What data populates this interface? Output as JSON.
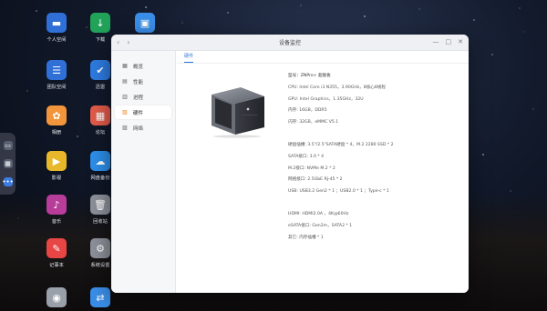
{
  "desktop": {
    "icons": [
      {
        "name": "personal-space",
        "label": "个人空间",
        "color": "#2f6fd6",
        "glyph": "▬"
      },
      {
        "name": "download",
        "label": "下载",
        "color": "#22a35a",
        "glyph": "↓"
      },
      {
        "name": "app-blue",
        "label": "",
        "color": "#3a8ee8",
        "glyph": "▣"
      },
      {
        "name": "team-space",
        "label": "团队空间",
        "color": "#2f6fd6",
        "glyph": "☰"
      },
      {
        "name": "app-v",
        "label": "迅雷",
        "color": "#2d7be0",
        "glyph": "✔"
      },
      {
        "name": "photos",
        "label": "相册",
        "color": "#f2953b",
        "glyph": "✿"
      },
      {
        "name": "app-multi",
        "label": "论坛",
        "color": "#e25b4a",
        "glyph": "▦"
      },
      {
        "name": "movies",
        "label": "影视",
        "color": "#e8b82a",
        "glyph": "▶"
      },
      {
        "name": "cloud-drive",
        "label": "网盘备份",
        "color": "#2d8ee8",
        "glyph": "☁"
      },
      {
        "name": "music",
        "label": "音乐",
        "color": "#b83c9a",
        "glyph": "♪"
      },
      {
        "name": "recycle-bin",
        "label": "回收站",
        "color": "#8c9099",
        "glyph": "🗑"
      },
      {
        "name": "notes",
        "label": "记事本",
        "color": "#e84545",
        "glyph": "✎"
      },
      {
        "name": "system-settings",
        "label": "系统设置",
        "color": "#8c9099",
        "glyph": "⚙"
      },
      {
        "name": "app-gray",
        "label": "",
        "color": "#9aa0aa",
        "glyph": "◉"
      },
      {
        "name": "app-transfer",
        "label": "",
        "color": "#3a8ee8",
        "glyph": "⇄"
      }
    ]
  },
  "dock": {
    "items": [
      "monitor-icon",
      "grid-icon",
      "more-icon"
    ]
  },
  "window": {
    "title": "设备监控",
    "back_glyph": "‹",
    "forward_glyph": "›",
    "minimize_glyph": "—",
    "maximize_glyph": "□",
    "close_glyph": "✕",
    "sidebar": [
      {
        "label": "概览",
        "glyph": "▦",
        "active": false
      },
      {
        "label": "性能",
        "glyph": "▤",
        "active": false
      },
      {
        "label": "进程",
        "glyph": "▥",
        "active": false
      },
      {
        "label": "硬件",
        "glyph": "▧",
        "active": true
      },
      {
        "label": "网络",
        "glyph": "▨",
        "active": false
      }
    ],
    "tab": "硬件",
    "specs": {
      "model": "型号：ZNPro+ 超能板",
      "cpu": "CPU: Intel Core i3 N355，3.90GHz，8核心8线程",
      "gpu": "GPU: Intel Graphics，1.35GHz，32U",
      "memory": "内存: 16GB，DDR5",
      "flash": "闪存: 32GB，eMMC V5.1",
      "disk_slots": "硬盘插槽: 3.5\"/2.5\"SATA硬盘 * 4，M.2 2280 SSD * 2",
      "sata": "SATA接口: 3.0 * 4",
      "m2": "M.2接口: NVMe M.2 * 2",
      "lan": "网络接口: 2.5GbE RJ-45 * 2",
      "usb": "USB: USB3.2 Gen2 * 1 ；USB2.0 * 1 ；Type-c * 1",
      "hdmi": "HDMI: HDMI2.0A ，4K@60Hz",
      "esata": "eSATA接口: Gen2m，SATA2 * 1",
      "other": "其它: 内存插槽 * 1"
    }
  }
}
